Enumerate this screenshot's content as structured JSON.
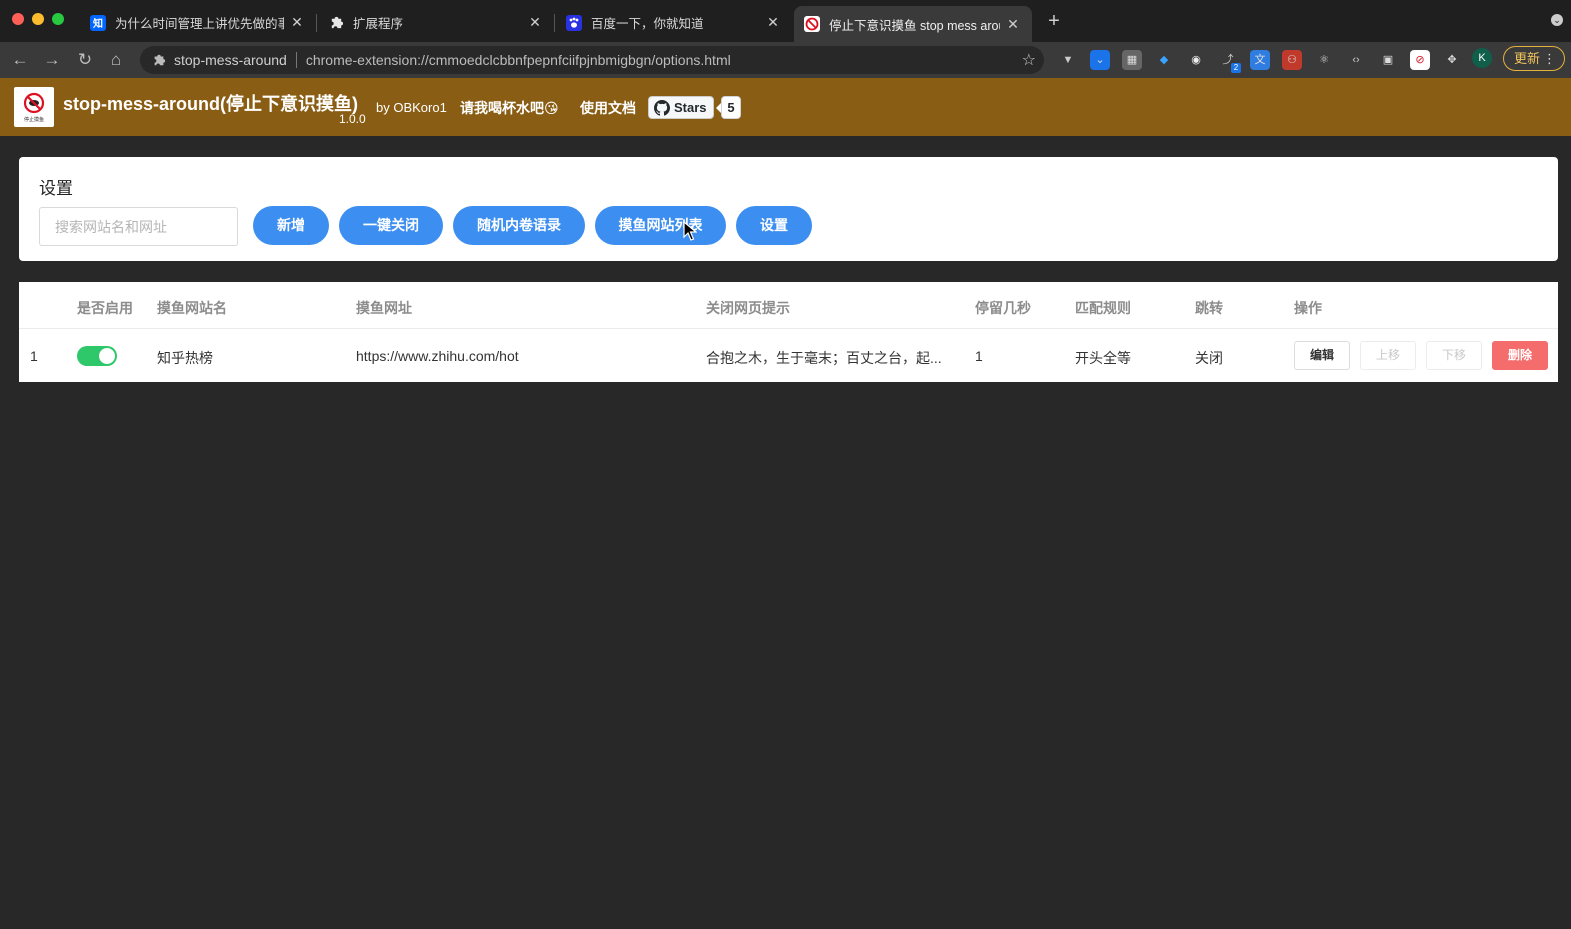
{
  "browser": {
    "tabs": [
      {
        "title": "为什么时间管理上讲优先做的事",
        "favicon": "知",
        "favicon_color": "#0066ff"
      },
      {
        "title": "扩展程序",
        "favicon": "puzzle-icon"
      },
      {
        "title": "百度一下，你就知道",
        "favicon": "baidu-paw-icon",
        "favicon_color": "#2932e1"
      },
      {
        "title": "停止下意识摸鱼 stop mess arou",
        "favicon": "stop-mess-icon",
        "active": true
      }
    ],
    "address_site": "stop-mess-around",
    "address_url": "chrome-extension://cmmoedclcbbnfpepnfciifpjnbmigbgn/options.html",
    "extension_badge": "2",
    "profile_initial": "K",
    "update_label": "更新"
  },
  "header": {
    "title": "stop-mess-around(停止下意识摸鱼)",
    "version": "1.0.0",
    "by": "by OBKoro1",
    "links": [
      "请我喝杯水吧😘",
      "使用文档"
    ],
    "github_label": "Stars",
    "github_count": "5",
    "logo_text": "停止摸鱼",
    "color": "#8a5d14"
  },
  "settings": {
    "title": "设置",
    "search_placeholder": "搜索网站名和网址",
    "buttons": [
      "新增",
      "一键关闭",
      "随机内卷语录",
      "摸鱼网站列表",
      "设置"
    ],
    "button_color": "#3c8ef0"
  },
  "table": {
    "headers": [
      "是否启用",
      "摸鱼网站名",
      "摸鱼网址",
      "关闭网页提示",
      "停留几秒",
      "匹配规则",
      "跳转",
      "操作"
    ],
    "rows": [
      {
        "index": "1",
        "enabled": true,
        "name": "知乎热榜",
        "url": "https://www.zhihu.com/hot",
        "tip": "合抱之木，生于毫末；百丈之台，起...",
        "seconds": "1",
        "rule": "开头全等",
        "redirect": "关闭",
        "actions": [
          "编辑",
          "上移",
          "下移",
          "删除"
        ]
      }
    ]
  }
}
